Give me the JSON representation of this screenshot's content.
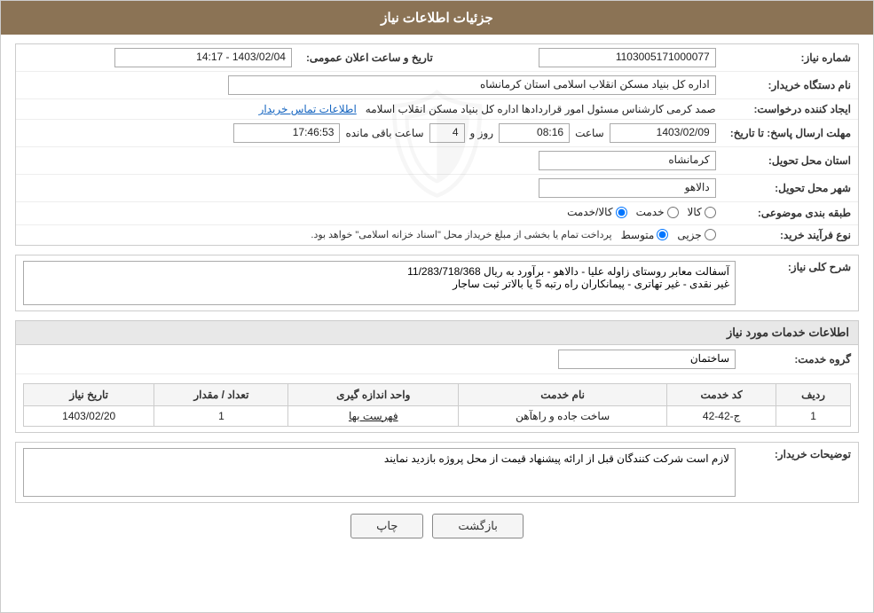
{
  "header": {
    "title": "جزئیات اطلاعات نیاز"
  },
  "fields": {
    "need_number_label": "شماره نیاز:",
    "need_number_value": "1103005171000077",
    "buyer_org_label": "نام دستگاه خریدار:",
    "buyer_org_value": "اداره کل بنیاد مسکن انقلاب اسلامی استان کرمانشاه",
    "creator_label": "ایجاد کننده درخواست:",
    "creator_value": "صمد کرمی کارشناس مسئول امور قراردادها اداره کل بنیاد مسکن انقلاب اسلامه",
    "creator_link": "اطلاعات تماس خریدار",
    "send_date_label": "مهلت ارسال پاسخ: تا تاریخ:",
    "send_date_value": "1403/02/09",
    "send_time_label": "ساعت",
    "send_time_value": "08:16",
    "days_label": "روز و",
    "days_value": "4",
    "remaining_label": "ساعت باقی مانده",
    "remaining_value": "17:46:53",
    "announce_label": "تاریخ و ساعت اعلان عمومی:",
    "announce_value": "1403/02/04 - 14:17",
    "province_label": "استان محل تحویل:",
    "province_value": "کرمانشاه",
    "city_label": "شهر محل تحویل:",
    "city_value": "دالاهو",
    "category_label": "طبقه بندی موضوعی:",
    "category_options": [
      "کالا",
      "خدمت",
      "کالا/خدمت"
    ],
    "category_selected": "کالا",
    "process_label": "نوع فرآیند خرید:",
    "process_options": [
      "جزیی",
      "متوسط"
    ],
    "process_selected": "متوسط",
    "process_note": "پرداخت تمام یا بخشی از مبلغ خریداز محل \"اسناد خزانه اسلامی\" خواهد بود.",
    "description_label": "شرح کلی نیاز:",
    "description_value": "آسفالت معابر روستای زاوله علیا - دالاهو - برآورد به ریال  11/283/718/368\nغیر نقدی - غیر تهاتری - پیمانکاران راه رتبه 5 یا بالاتر ثبت ساجار",
    "service_section_title": "اطلاعات خدمات مورد نیاز",
    "service_group_label": "گروه خدمت:",
    "service_group_value": "ساختمان",
    "table_headers": {
      "row_num": "ردیف",
      "service_code": "کد خدمت",
      "service_name": "نام خدمت",
      "unit": "واحد اندازه گیری",
      "quantity": "تعداد / مقدار",
      "need_date": "تاریخ نیاز"
    },
    "table_rows": [
      {
        "row_num": "1",
        "service_code": "ج-42-42",
        "service_name": "ساخت جاده و راهآهن",
        "unit": "فهرست بها",
        "quantity": "1",
        "need_date": "1403/02/20"
      }
    ],
    "buyer_notes_label": "توضیحات خریدار:",
    "buyer_notes_value": "لازم است شرکت کنندگان قبل از ارائه پیشنهاد قیمت از محل پروژه بازدید نمایند"
  },
  "buttons": {
    "print_label": "چاپ",
    "back_label": "بازگشت"
  }
}
